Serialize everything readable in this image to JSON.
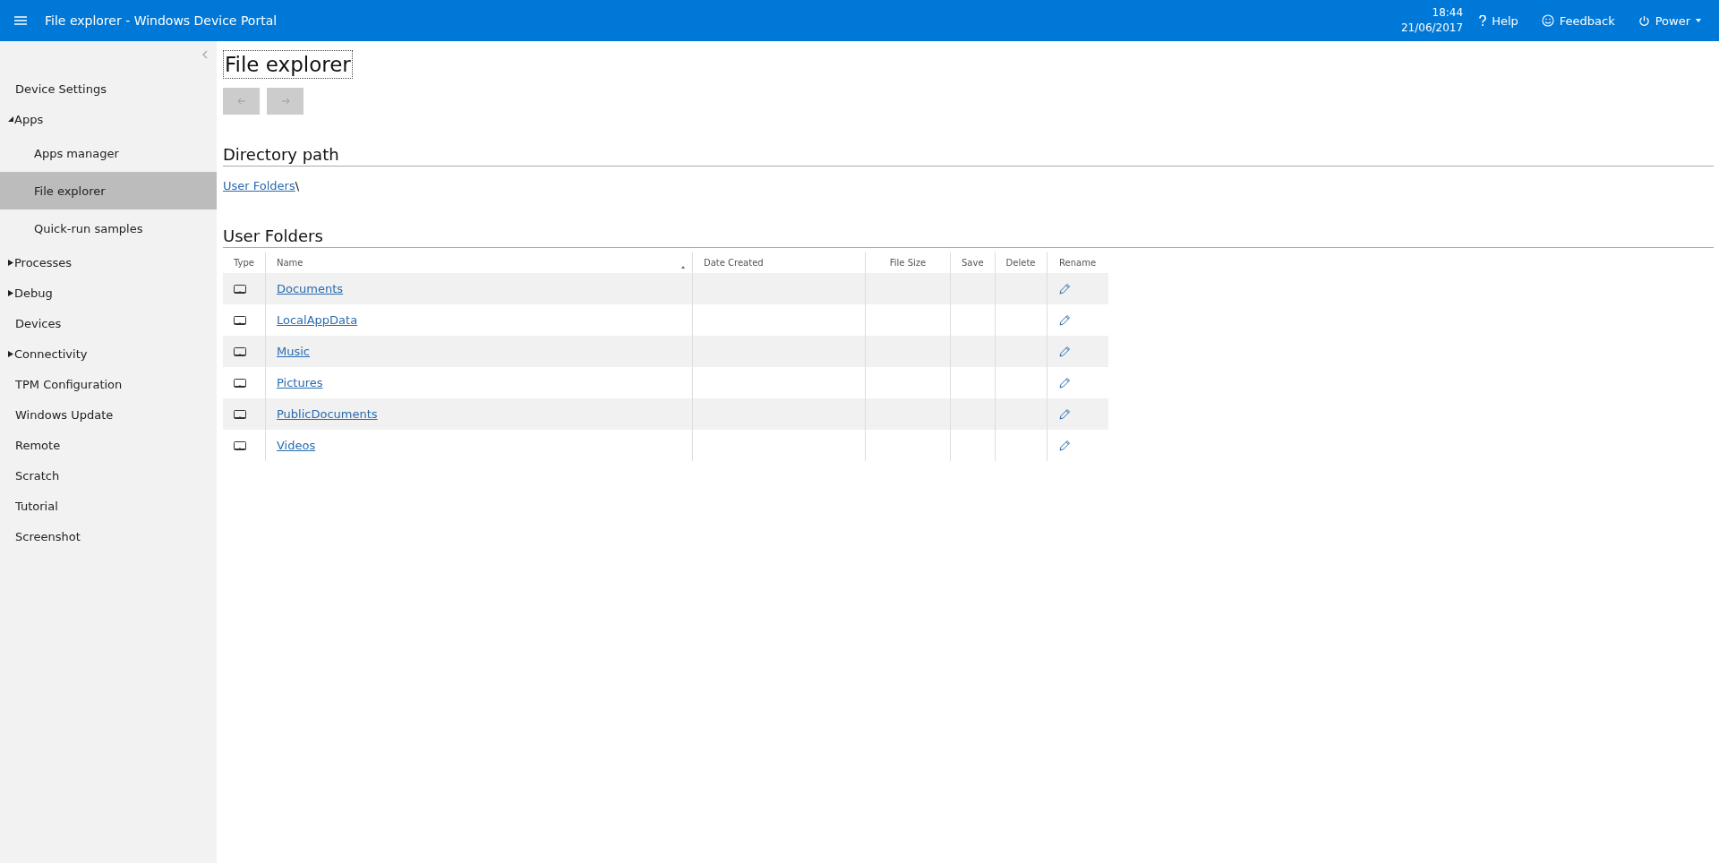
{
  "header": {
    "title": "File explorer - Windows Device Portal",
    "time": "18:44",
    "date": "21/06/2017",
    "actions": [
      {
        "kind": "help",
        "label": "Help"
      },
      {
        "kind": "feedback",
        "label": "Feedback"
      },
      {
        "kind": "power",
        "label": "Power"
      }
    ]
  },
  "sidebar": {
    "items": [
      {
        "label": "Device Settings",
        "selected": false
      },
      {
        "label": "Apps",
        "selected": false,
        "expanded": true,
        "children": [
          {
            "label": "Apps manager",
            "selected": false
          },
          {
            "label": "File explorer",
            "selected": true
          },
          {
            "label": "Quick-run samples",
            "selected": false
          }
        ]
      },
      {
        "label": "Processes",
        "selected": false,
        "expanded": false
      },
      {
        "label": "Debug",
        "selected": false,
        "expanded": false
      },
      {
        "label": "Devices",
        "selected": false
      },
      {
        "label": "Connectivity",
        "selected": false,
        "expanded": false
      },
      {
        "label": "TPM Configuration",
        "selected": false
      },
      {
        "label": "Windows Update",
        "selected": false
      },
      {
        "label": "Remote",
        "selected": false
      },
      {
        "label": "Scratch",
        "selected": false
      },
      {
        "label": "Tutorial",
        "selected": false
      },
      {
        "label": "Screenshot",
        "selected": false
      }
    ]
  },
  "page": {
    "title": "File explorer",
    "nav_buttons": [
      {
        "kind": "back",
        "disabled": true
      },
      {
        "kind": "forward",
        "disabled": true
      }
    ]
  },
  "directory_path": {
    "heading": "Directory path",
    "link": "User Folders",
    "separator": "\\"
  },
  "table": {
    "heading": "User Folders",
    "columns": [
      "Type",
      "Name",
      "Date Created",
      "File Size",
      "Save",
      "Delete",
      "Rename"
    ],
    "rows": [
      {
        "name": "Documents"
      },
      {
        "name": "LocalAppData"
      },
      {
        "name": "Music"
      },
      {
        "name": "Pictures"
      },
      {
        "name": "PublicDocuments"
      },
      {
        "name": "Videos"
      }
    ]
  }
}
